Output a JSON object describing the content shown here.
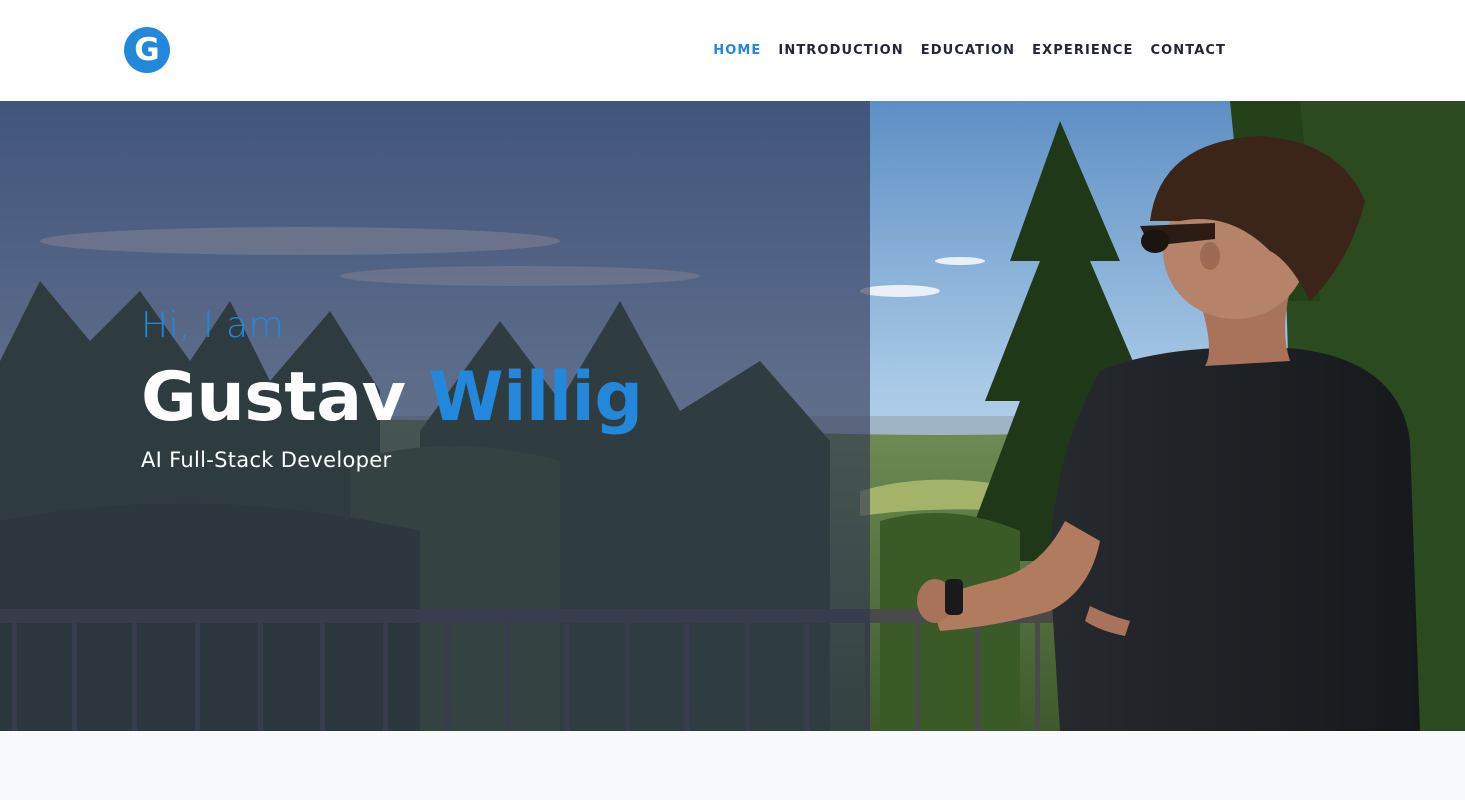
{
  "brand": {
    "logo_letter": "G"
  },
  "nav": {
    "items": [
      {
        "label": "HOME",
        "active": true
      },
      {
        "label": "INTRODUCTION",
        "active": false
      },
      {
        "label": "EDUCATION",
        "active": false
      },
      {
        "label": "EXPERIENCE",
        "active": false
      },
      {
        "label": "CONTACT",
        "active": false
      }
    ]
  },
  "hero": {
    "greeting": "Hi, I am",
    "first_name": "Gustav",
    "last_name": "Willig",
    "role": "AI Full-Stack Developer",
    "photo_alt": "Person in sunglasses leaning on a railing overlooking a forested valley"
  },
  "colors": {
    "accent": "#2388dc",
    "nav_text": "#232636",
    "overlay": "#2e3450",
    "band": "#f8f9fb"
  }
}
